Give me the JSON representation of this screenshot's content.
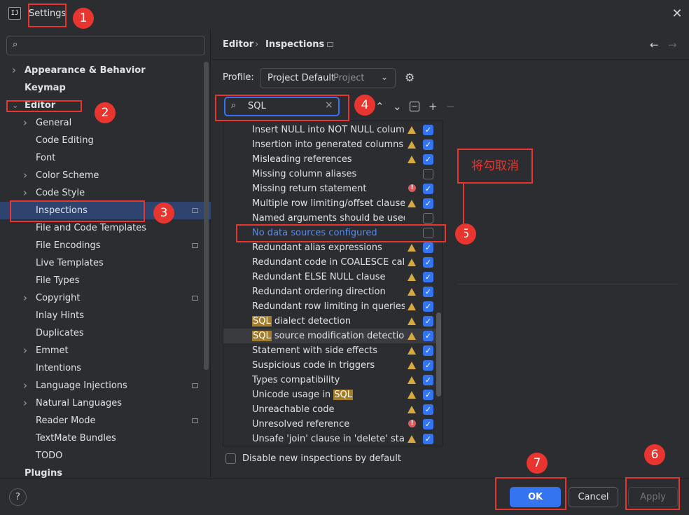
{
  "window": {
    "title": "Settings",
    "logo_text": "IJ"
  },
  "sidebar": {
    "search_placeholder": "",
    "items": [
      {
        "label": "Appearance & Behavior",
        "level": 0,
        "chevron": "right",
        "bold": true
      },
      {
        "label": "Keymap",
        "level": 0,
        "bold": true
      },
      {
        "label": "Editor",
        "level": 0,
        "chevron": "down",
        "bold": true
      },
      {
        "label": "General",
        "level": 1,
        "chevron": "right"
      },
      {
        "label": "Code Editing",
        "level": 1
      },
      {
        "label": "Font",
        "level": 1
      },
      {
        "label": "Color Scheme",
        "level": 1,
        "chevron": "right"
      },
      {
        "label": "Code Style",
        "level": 1,
        "chevron": "right"
      },
      {
        "label": "Inspections",
        "level": 1,
        "selected": true,
        "project_icon": true
      },
      {
        "label": "File and Code Templates",
        "level": 1
      },
      {
        "label": "File Encodings",
        "level": 1,
        "project_icon": true
      },
      {
        "label": "Live Templates",
        "level": 1
      },
      {
        "label": "File Types",
        "level": 1
      },
      {
        "label": "Copyright",
        "level": 1,
        "chevron": "right",
        "project_icon": true
      },
      {
        "label": "Inlay Hints",
        "level": 1
      },
      {
        "label": "Duplicates",
        "level": 1
      },
      {
        "label": "Emmet",
        "level": 1,
        "chevron": "right"
      },
      {
        "label": "Intentions",
        "level": 1
      },
      {
        "label": "Language Injections",
        "level": 1,
        "chevron": "right",
        "project_icon": true
      },
      {
        "label": "Natural Languages",
        "level": 1,
        "chevron": "right"
      },
      {
        "label": "Reader Mode",
        "level": 1,
        "project_icon": true
      },
      {
        "label": "TextMate Bundles",
        "level": 1
      },
      {
        "label": "TODO",
        "level": 1
      },
      {
        "label": "Plugins",
        "level": 0,
        "bold": true
      }
    ]
  },
  "breadcrumb": {
    "parent": "Editor",
    "separator": "›",
    "current": "Inspections"
  },
  "profile": {
    "label": "Profile:",
    "value": "Project Default",
    "kind": "Project"
  },
  "filter": {
    "value": "SQL"
  },
  "inspections": [
    {
      "parts": [
        {
          "t": "Insert NULL into NOT NULL column"
        }
      ],
      "severity": "warning",
      "checked": true
    },
    {
      "parts": [
        {
          "t": "Insertion into generated columns"
        }
      ],
      "severity": "warning",
      "checked": true
    },
    {
      "parts": [
        {
          "t": "Misleading references"
        }
      ],
      "severity": "warning",
      "checked": true
    },
    {
      "parts": [
        {
          "t": "Missing column aliases"
        }
      ],
      "severity": "none",
      "checked": false
    },
    {
      "parts": [
        {
          "t": "Missing return statement"
        }
      ],
      "severity": "error",
      "checked": true
    },
    {
      "parts": [
        {
          "t": "Multiple row limiting/offset clauses in"
        }
      ],
      "severity": "warning",
      "checked": true
    },
    {
      "parts": [
        {
          "t": "Named arguments should be used"
        }
      ],
      "severity": "none",
      "checked": false
    },
    {
      "parts": [
        {
          "t": "No data sources configured"
        }
      ],
      "severity": "none",
      "checked": false,
      "link": true
    },
    {
      "parts": [
        {
          "t": "Redundant alias expressions"
        }
      ],
      "severity": "warning",
      "checked": true
    },
    {
      "parts": [
        {
          "t": "Redundant code in COALESCE call"
        }
      ],
      "severity": "warning",
      "checked": true
    },
    {
      "parts": [
        {
          "t": "Redundant ELSE NULL clause"
        }
      ],
      "severity": "warning",
      "checked": true
    },
    {
      "parts": [
        {
          "t": "Redundant ordering direction"
        }
      ],
      "severity": "warning",
      "checked": true
    },
    {
      "parts": [
        {
          "t": "Redundant row limiting in queries"
        }
      ],
      "severity": "warning",
      "checked": true
    },
    {
      "parts": [
        {
          "t": "SQL",
          "hl": true
        },
        {
          "t": " dialect detection"
        }
      ],
      "severity": "warning",
      "checked": true
    },
    {
      "parts": [
        {
          "t": "SQL",
          "hl": true
        },
        {
          "t": " source modification detection"
        }
      ],
      "severity": "warning",
      "checked": true,
      "hover": true
    },
    {
      "parts": [
        {
          "t": "Statement with side effects"
        }
      ],
      "severity": "warning",
      "checked": true
    },
    {
      "parts": [
        {
          "t": "Suspicious code in triggers"
        }
      ],
      "severity": "warning",
      "checked": true
    },
    {
      "parts": [
        {
          "t": "Types compatibility"
        }
      ],
      "severity": "warning",
      "checked": true
    },
    {
      "parts": [
        {
          "t": "Unicode usage in "
        },
        {
          "t": "SQL",
          "hl": true
        }
      ],
      "severity": "warning",
      "checked": true
    },
    {
      "parts": [
        {
          "t": "Unreachable code"
        }
      ],
      "severity": "warning",
      "checked": true
    },
    {
      "parts": [
        {
          "t": "Unresolved reference"
        }
      ],
      "severity": "error",
      "checked": true
    },
    {
      "parts": [
        {
          "t": "Unsafe 'join' clause in 'delete' stateme"
        }
      ],
      "severity": "warning",
      "checked": true
    }
  ],
  "disable_new": {
    "label": "Disable new inspections by default",
    "checked": false
  },
  "buttons": {
    "ok": "OK",
    "cancel": "Cancel",
    "apply": "Apply",
    "help": "?"
  },
  "annotations": {
    "badges": [
      "1",
      "2",
      "3",
      "4",
      "5",
      "6",
      "7"
    ],
    "note": "将勾取消"
  },
  "colors": {
    "accent": "#3574f0",
    "annotation": "#e8352f",
    "warning": "#d7a93f",
    "error": "#db5c5c",
    "link": "#548af7"
  }
}
